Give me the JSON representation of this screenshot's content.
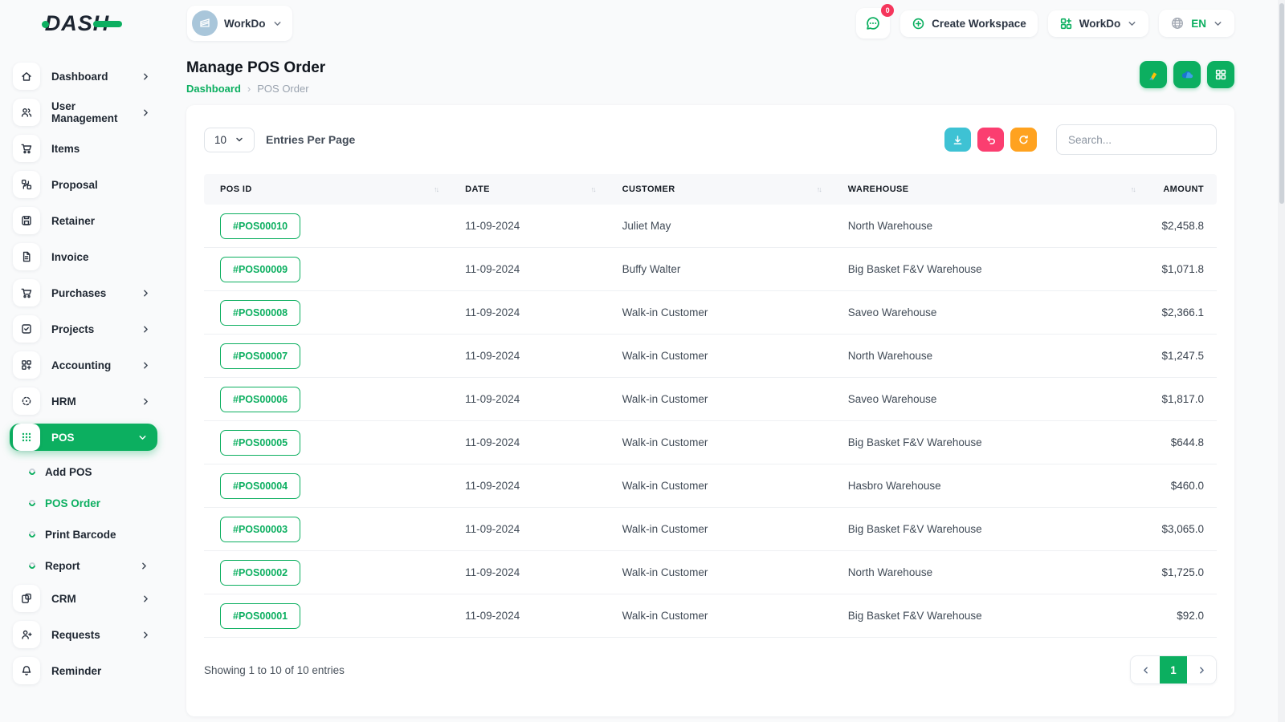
{
  "brand": {
    "logo_text": "DASH"
  },
  "topbar": {
    "workspace_selector_label": "WorkDo",
    "messages_badge": "0",
    "create_workspace_label": "Create Workspace",
    "workdo_menu_label": "WorkDo",
    "language": "EN"
  },
  "sidebar": {
    "main_items": [
      {
        "label": "Dashboard",
        "icon": "home-icon",
        "has_chevron": true
      },
      {
        "label": "User Management",
        "icon": "users-icon",
        "has_chevron": true
      },
      {
        "label": "Items",
        "icon": "cart-icon",
        "has_chevron": false
      },
      {
        "label": "Proposal",
        "icon": "swap-boxes-icon",
        "has_chevron": false
      },
      {
        "label": "Retainer",
        "icon": "save-icon",
        "has_chevron": false
      },
      {
        "label": "Invoice",
        "icon": "file-icon",
        "has_chevron": false
      },
      {
        "label": "Purchases",
        "icon": "cart-icon",
        "has_chevron": true
      },
      {
        "label": "Projects",
        "icon": "check-square-icon",
        "has_chevron": true
      },
      {
        "label": "Accounting",
        "icon": "grid-plus-icon",
        "has_chevron": true
      },
      {
        "label": "HRM",
        "icon": "target-icon",
        "has_chevron": true
      },
      {
        "label": "POS",
        "icon": "dots-grid-icon",
        "has_chevron": true,
        "active": true
      }
    ],
    "pos_subitems": [
      {
        "label": "Add POS",
        "active": false
      },
      {
        "label": "POS Order",
        "active": true
      },
      {
        "label": "Print Barcode",
        "active": false
      },
      {
        "label": "Report",
        "active": false,
        "has_chevron": true
      }
    ],
    "tail_items": [
      {
        "label": "CRM",
        "icon": "crm-icon",
        "has_chevron": true
      },
      {
        "label": "Requests",
        "icon": "user-plus-icon",
        "has_chevron": true
      },
      {
        "label": "Reminder",
        "icon": "bell-icon",
        "has_chevron": false
      }
    ]
  },
  "page": {
    "title": "Manage POS Order",
    "breadcrumb_home": "Dashboard",
    "breadcrumb_current": "POS Order"
  },
  "toolbar": {
    "entries_value": "10",
    "entries_label": "Entries Per Page",
    "search_placeholder": "Search..."
  },
  "table": {
    "columns": [
      "POS ID",
      "DATE",
      "CUSTOMER",
      "WAREHOUSE",
      "AMOUNT"
    ],
    "rows": [
      {
        "pos_id": "#POS00010",
        "date": "11-09-2024",
        "customer": "Juliet May",
        "warehouse": "North Warehouse",
        "amount": "$2,458.8"
      },
      {
        "pos_id": "#POS00009",
        "date": "11-09-2024",
        "customer": "Buffy Walter",
        "warehouse": "Big Basket F&V Warehouse",
        "amount": "$1,071.8"
      },
      {
        "pos_id": "#POS00008",
        "date": "11-09-2024",
        "customer": "Walk-in Customer",
        "warehouse": "Saveo Warehouse",
        "amount": "$2,366.1"
      },
      {
        "pos_id": "#POS00007",
        "date": "11-09-2024",
        "customer": "Walk-in Customer",
        "warehouse": "North Warehouse",
        "amount": "$1,247.5"
      },
      {
        "pos_id": "#POS00006",
        "date": "11-09-2024",
        "customer": "Walk-in Customer",
        "warehouse": "Saveo Warehouse",
        "amount": "$1,817.0"
      },
      {
        "pos_id": "#POS00005",
        "date": "11-09-2024",
        "customer": "Walk-in Customer",
        "warehouse": "Big Basket F&V Warehouse",
        "amount": "$644.8"
      },
      {
        "pos_id": "#POS00004",
        "date": "11-09-2024",
        "customer": "Walk-in Customer",
        "warehouse": "Hasbro Warehouse",
        "amount": "$460.0"
      },
      {
        "pos_id": "#POS00003",
        "date": "11-09-2024",
        "customer": "Walk-in Customer",
        "warehouse": "Big Basket F&V Warehouse",
        "amount": "$3,065.0"
      },
      {
        "pos_id": "#POS00002",
        "date": "11-09-2024",
        "customer": "Walk-in Customer",
        "warehouse": "North Warehouse",
        "amount": "$1,725.0"
      },
      {
        "pos_id": "#POS00001",
        "date": "11-09-2024",
        "customer": "Walk-in Customer",
        "warehouse": "Big Basket F&V Warehouse",
        "amount": "$92.0"
      }
    ],
    "footer": {
      "showing_text": "Showing 1 to 10 of 10 entries",
      "current_page": "1"
    }
  },
  "colors": {
    "accent_green": "#0caf60",
    "teal_button": "#3ec2d4",
    "pink_button": "#fb3e70",
    "orange_button": "#ffa21f",
    "badge_red": "#f5365c",
    "logo_dark": "#1c2430"
  }
}
